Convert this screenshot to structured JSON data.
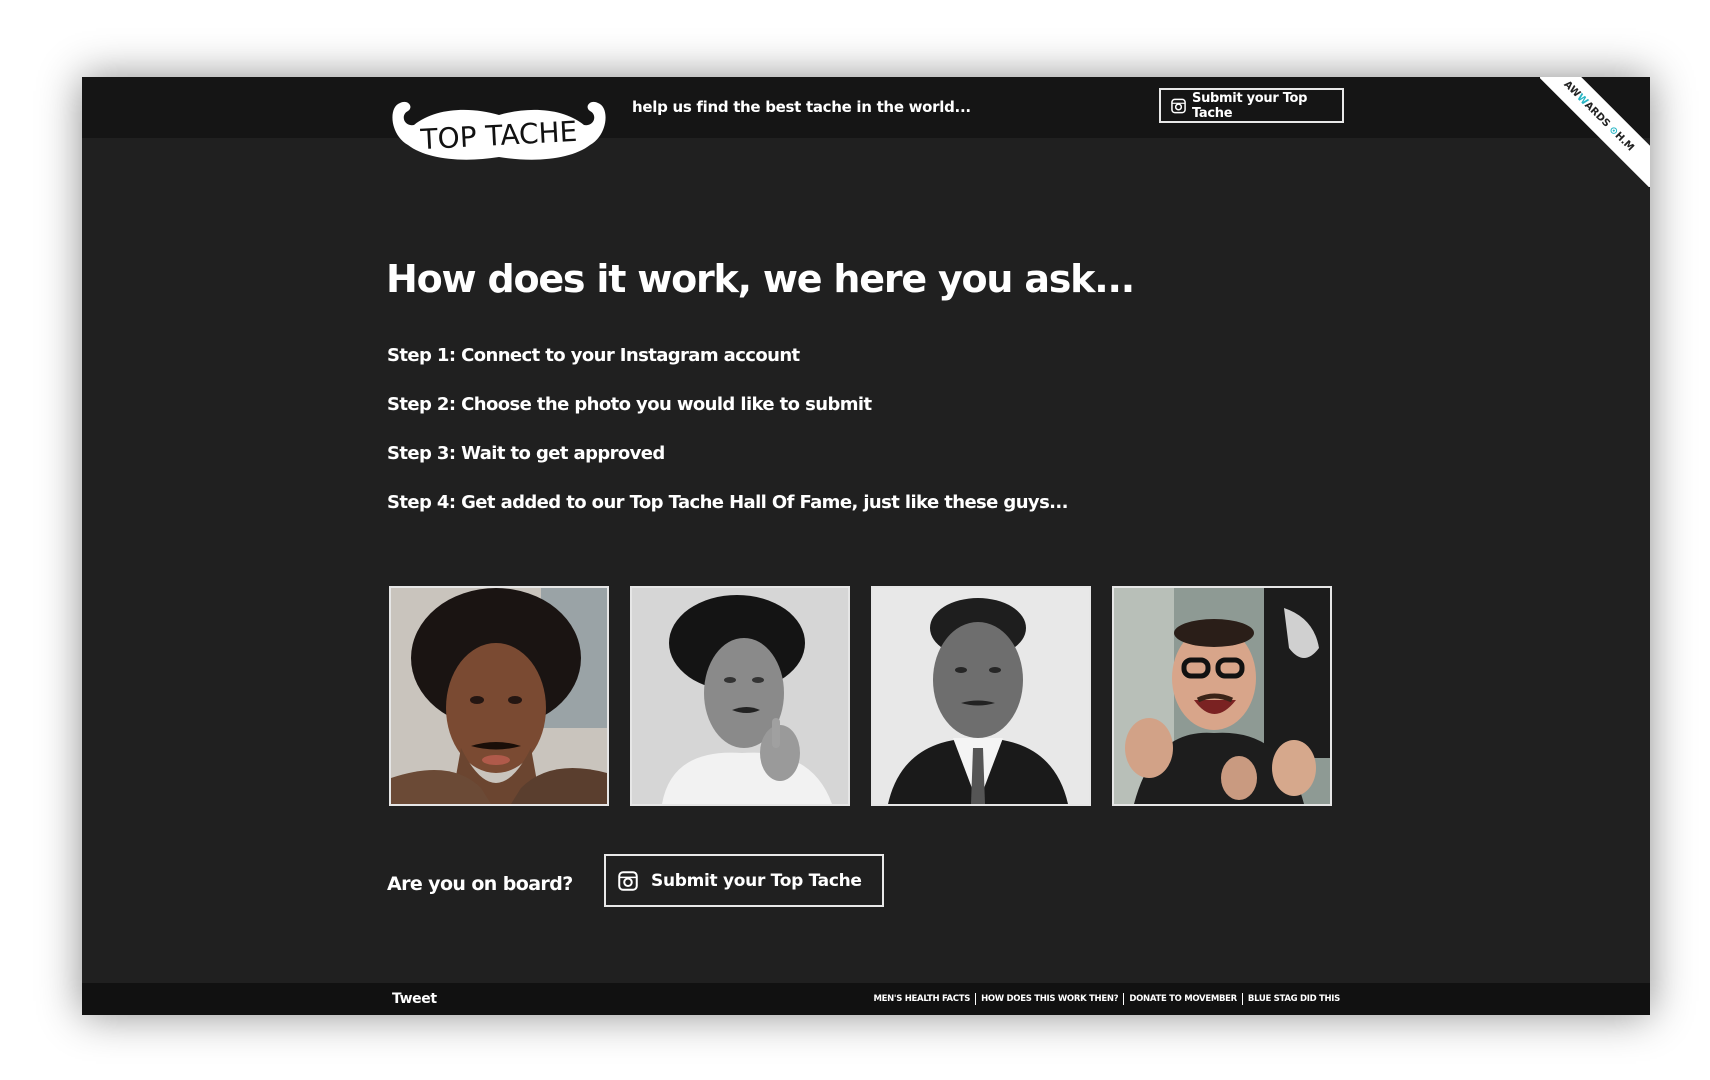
{
  "header": {
    "logo_text": "TOP TACHE",
    "tagline": "help us find the best tache in the world...",
    "submit_label": "Submit your Top Tache",
    "ribbon": {
      "prefix": "AW",
      "accent": "W",
      "middle": "ARDS",
      "suffix": "H.M"
    }
  },
  "main": {
    "title": "How does it work, we here you ask...",
    "steps": [
      "Step 1: Connect to your Instagram account",
      "Step 2: Choose the photo you would like to submit",
      "Step 3: Wait to get approved",
      "Step 4: Get added to our Top Tache Hall Of Fame, just like these guys..."
    ],
    "gallery": [
      {
        "icon": "man-with-afro-mustache-photo"
      },
      {
        "icon": "man-black-white-thinking-photo"
      },
      {
        "icon": "man-in-suit-mustache-photo"
      },
      {
        "icon": "man-laughing-glasses-photo"
      }
    ],
    "board_label": "Are you on board?",
    "submit_label": "Submit your Top Tache"
  },
  "footer": {
    "tweet_label": "Tweet",
    "links": [
      "MEN'S HEALTH FACTS",
      "HOW DOES THIS WORK THEN?",
      "DONATE TO MOVEMBER",
      "BLUE STAG DID THIS"
    ]
  },
  "colors": {
    "background": "#202020",
    "header": "#151515",
    "footer": "#111111",
    "text": "#ffffff",
    "accent": "#27b6c5"
  }
}
